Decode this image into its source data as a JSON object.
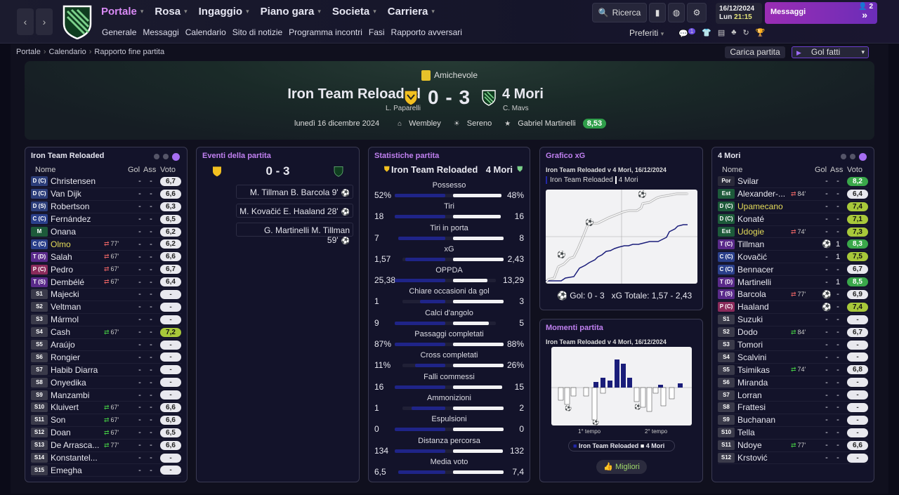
{
  "topbar": {
    "nav": [
      {
        "label": "Portale",
        "active": true
      },
      {
        "label": "Rosa"
      },
      {
        "label": "Ingaggio"
      },
      {
        "label": "Piano gara"
      },
      {
        "label": "Societa"
      },
      {
        "label": "Carriera"
      }
    ],
    "subnav": [
      "Generale",
      "Messaggi",
      "Calendario",
      "Sito di notizie",
      "Programma incontri",
      "Fasi",
      "Rapporto avversari"
    ],
    "search": "Ricerca",
    "date": "16/12/2024",
    "day": "Lun",
    "time": "21:15",
    "messages": "Messaggi",
    "msg_count": "2",
    "favorites": "Preferiti",
    "notif": "1"
  },
  "breadcrumb": [
    "Portale",
    "Calendario",
    "Rapporto fine partita"
  ],
  "actions": {
    "load": "Carica partita",
    "goals": "Gol fatti"
  },
  "match": {
    "competition": "Amichevole",
    "home": "Iron Team Reloaded",
    "home_coach": "L. Paparelli",
    "away": "4 Mori",
    "away_coach": "C. Mavs",
    "score": "0 - 3",
    "date": "lunedì 16 dicembre 2024",
    "stadium": "Wembley",
    "weather": "Sereno",
    "referee": "Gabriel Martinelli",
    "ref_rating": "8,53"
  },
  "colors": {
    "accent": "#a66ef3",
    "home_bar": "#1f2488",
    "away_bar": "#f2f2f4"
  },
  "home_lineup": {
    "title": "Iron Team Reloaded",
    "cols": [
      "Nome",
      "Gol",
      "Ass",
      "Voto"
    ],
    "players": [
      {
        "pos": "D (C)",
        "c": "#2c3e7a",
        "name": "Christensen",
        "sub": "",
        "g": "-",
        "a": "-",
        "v": "6,7"
      },
      {
        "pos": "D (C)",
        "c": "#2c3e7a",
        "name": "Van Dijk",
        "sub": "",
        "g": "-",
        "a": "-",
        "v": "6,6"
      },
      {
        "pos": "D (S)",
        "c": "#2c3e7a",
        "name": "Robertson",
        "sub": "",
        "g": "-",
        "a": "-",
        "v": "6,3"
      },
      {
        "pos": "C (C)",
        "c": "#2a3f8a",
        "name": "Fernández",
        "sub": "",
        "g": "-",
        "a": "-",
        "v": "6,5"
      },
      {
        "pos": "M",
        "c": "#1d5a3a",
        "name": "Onana",
        "sub": "",
        "g": "-",
        "a": "-",
        "v": "6,2"
      },
      {
        "pos": "C (C)",
        "c": "#2a3f8a",
        "name": "Olmo",
        "hl": true,
        "sub": "77'",
        "s": "out",
        "g": "-",
        "a": "-",
        "v": "6,2"
      },
      {
        "pos": "T (D)",
        "c": "#5a2a8a",
        "name": "Salah",
        "sub": "67'",
        "s": "out",
        "g": "-",
        "a": "-",
        "v": "6,6"
      },
      {
        "pos": "P (C)",
        "c": "#8a2a5a",
        "name": "Pedro",
        "sub": "67'",
        "s": "out",
        "g": "-",
        "a": "-",
        "v": "6,7"
      },
      {
        "pos": "T (S)",
        "c": "#5a2a8a",
        "name": "Dembélé",
        "sub": "67'",
        "s": "out",
        "g": "-",
        "a": "-",
        "v": "6,4"
      },
      {
        "pos": "S1",
        "c": "#3a3a4a",
        "name": "Majecki",
        "sub": "",
        "g": "-",
        "a": "-",
        "v": "-"
      },
      {
        "pos": "S2",
        "c": "#3a3a4a",
        "name": "Veltman",
        "sub": "",
        "g": "-",
        "a": "-",
        "v": "-"
      },
      {
        "pos": "S3",
        "c": "#3a3a4a",
        "name": "Mármol",
        "sub": "",
        "g": "-",
        "a": "-",
        "v": "-"
      },
      {
        "pos": "S4",
        "c": "#3a3a4a",
        "name": "Cash",
        "sub": "67'",
        "s": "in",
        "g": "-",
        "a": "-",
        "v": "7,2"
      },
      {
        "pos": "S5",
        "c": "#3a3a4a",
        "name": "Araújo",
        "sub": "",
        "g": "-",
        "a": "-",
        "v": "-"
      },
      {
        "pos": "S6",
        "c": "#3a3a4a",
        "name": "Rongier",
        "sub": "",
        "g": "-",
        "a": "-",
        "v": "-"
      },
      {
        "pos": "S7",
        "c": "#3a3a4a",
        "name": "Habib Diarra",
        "sub": "",
        "g": "-",
        "a": "-",
        "v": "-"
      },
      {
        "pos": "S8",
        "c": "#3a3a4a",
        "name": "Onyedika",
        "sub": "",
        "g": "-",
        "a": "-",
        "v": "-"
      },
      {
        "pos": "S9",
        "c": "#3a3a4a",
        "name": "Manzambi",
        "sub": "",
        "g": "-",
        "a": "-",
        "v": "-"
      },
      {
        "pos": "S10",
        "c": "#3a3a4a",
        "name": "Kluivert",
        "sub": "67'",
        "s": "in",
        "g": "-",
        "a": "-",
        "v": "6,6"
      },
      {
        "pos": "S11",
        "c": "#3a3a4a",
        "name": "Son",
        "sub": "67'",
        "s": "in",
        "g": "-",
        "a": "-",
        "v": "6,6"
      },
      {
        "pos": "S12",
        "c": "#3a3a4a",
        "name": "Doan",
        "sub": "67'",
        "s": "in",
        "g": "-",
        "a": "-",
        "v": "6,5"
      },
      {
        "pos": "S13",
        "c": "#3a3a4a",
        "name": "De Arrasca...",
        "sub": "77'",
        "s": "in",
        "g": "-",
        "a": "-",
        "v": "6,6"
      },
      {
        "pos": "S14",
        "c": "#3a3a4a",
        "name": "Konstantel...",
        "sub": "",
        "g": "-",
        "a": "-",
        "v": "-"
      },
      {
        "pos": "S15",
        "c": "#3a3a4a",
        "name": "Emegha",
        "sub": "",
        "g": "-",
        "a": "-",
        "v": "-"
      }
    ]
  },
  "events": {
    "title": "Eventi della partita",
    "score": "0 - 3",
    "rows": [
      "M. Tillman B. Barcola 9'",
      "M. Kovačić E. Haaland 28'",
      "G. Martinelli M. Tillman 59'"
    ]
  },
  "stats": {
    "title": "Statistiche partita",
    "home": "Iron Team Reloaded",
    "away": "4 Mori",
    "rows": [
      {
        "label": "Possesso",
        "h": "52%",
        "a": "48%",
        "hv": 52,
        "av": 48
      },
      {
        "label": "Tiri",
        "h": "18",
        "a": "16",
        "hv": 18,
        "av": 16
      },
      {
        "label": "Tiri in porta",
        "h": "7",
        "a": "8",
        "hv": 7,
        "av": 8
      },
      {
        "label": "xG",
        "h": "1,57",
        "a": "2,43",
        "hv": 1.57,
        "av": 2.43
      },
      {
        "label": "OPPDA",
        "h": "25,38",
        "a": "13,29",
        "hv": 25.38,
        "av": 13.29
      },
      {
        "label": "Chiare occasioni da gol",
        "h": "1",
        "a": "3",
        "hv": 1,
        "av": 3
      },
      {
        "label": "Calci d'angolo",
        "h": "9",
        "a": "5",
        "hv": 9,
        "av": 5
      },
      {
        "label": "Passaggi completati",
        "h": "87%",
        "a": "88%",
        "hv": 87,
        "av": 88
      },
      {
        "label": "Cross completati",
        "h": "11%",
        "a": "26%",
        "hv": 11,
        "av": 26
      },
      {
        "label": "Falli commessi",
        "h": "16",
        "a": "15",
        "hv": 16,
        "av": 15
      },
      {
        "label": "Ammonizioni",
        "h": "1",
        "a": "2",
        "hv": 1,
        "av": 2
      },
      {
        "label": "Espulsioni",
        "h": "0",
        "a": "0",
        "hv": 0,
        "av": 0
      },
      {
        "label": "Distanza percorsa",
        "h": "134",
        "a": "132",
        "hv": 134,
        "av": 132
      },
      {
        "label": "Media voto",
        "h": "6,5",
        "a": "7,4",
        "hv": 6.5,
        "av": 7.4
      }
    ]
  },
  "xg": {
    "title": "Grafico xG",
    "subtitle": "Iron Team Reloaded v 4 Mori, 16/12/2024",
    "legend_home": "Iron Team Reloaded",
    "legend_away": "4 Mori",
    "goals": "Gol: 0 - 3",
    "total": "xG Totale: 1,57 - 2,43"
  },
  "moments": {
    "title": "Momenti partita",
    "subtitle": "Iron Team Reloaded v 4 Mori, 16/12/2024",
    "first": "1° tempo",
    "second": "2° tempo",
    "legend_home": "Iron Team Reloaded",
    "legend_away": "4 Mori",
    "button": "Migliori"
  },
  "away_lineup": {
    "title": "4 Mori",
    "cols": [
      "Nome",
      "Gol",
      "Ass",
      "Voto"
    ],
    "players": [
      {
        "pos": "Por",
        "c": "#2a2a3a",
        "name": "Svilar",
        "sub": "",
        "g": "-",
        "a": "-",
        "v": "8,2"
      },
      {
        "pos": "Est",
        "c": "#1d5a3a",
        "name": "Alexander-...",
        "sub": "84'",
        "s": "out",
        "g": "-",
        "a": "-",
        "v": "6,4"
      },
      {
        "pos": "D (C)",
        "c": "#1d5a3a",
        "name": "Upamecano",
        "hl": true,
        "sub": "",
        "g": "-",
        "a": "-",
        "v": "7,4"
      },
      {
        "pos": "D (C)",
        "c": "#1d5a3a",
        "name": "Konaté",
        "sub": "",
        "g": "-",
        "a": "-",
        "v": "7,1"
      },
      {
        "pos": "Est",
        "c": "#1d5a3a",
        "name": "Udogie",
        "hl": true,
        "sub": "74'",
        "s": "out",
        "g": "-",
        "a": "-",
        "v": "7,3"
      },
      {
        "pos": "T (C)",
        "c": "#5a2a8a",
        "name": "Tillman",
        "sub": "",
        "g": "⚽",
        "a": "1",
        "v": "8,3"
      },
      {
        "pos": "C (C)",
        "c": "#2a3f8a",
        "name": "Kovačić",
        "sub": "",
        "g": "-",
        "a": "1",
        "v": "7,5"
      },
      {
        "pos": "C (C)",
        "c": "#2a3f8a",
        "name": "Bennacer",
        "sub": "",
        "g": "-",
        "a": "-",
        "v": "6,7"
      },
      {
        "pos": "T (D)",
        "c": "#5a2a8a",
        "name": "Martinelli",
        "sub": "",
        "g": "-",
        "a": "1",
        "v": "8,5"
      },
      {
        "pos": "T (S)",
        "c": "#5a2a8a",
        "name": "Barcola",
        "sub": "77'",
        "s": "out",
        "g": "⚽",
        "a": "-",
        "v": "6,9"
      },
      {
        "pos": "P (C)",
        "c": "#8a2a5a",
        "name": "Haaland",
        "sub": "",
        "g": "⚽",
        "a": "-",
        "v": "7,4"
      },
      {
        "pos": "S1",
        "c": "#3a3a4a",
        "name": "Suzuki",
        "sub": "",
        "g": "-",
        "a": "-",
        "v": "-"
      },
      {
        "pos": "S2",
        "c": "#3a3a4a",
        "name": "Dodo",
        "sub": "84'",
        "s": "in",
        "g": "-",
        "a": "-",
        "v": "6,7"
      },
      {
        "pos": "S3",
        "c": "#3a3a4a",
        "name": "Tomori",
        "sub": "",
        "g": "-",
        "a": "-",
        "v": "-"
      },
      {
        "pos": "S4",
        "c": "#3a3a4a",
        "name": "Scalvini",
        "sub": "",
        "g": "-",
        "a": "-",
        "v": "-"
      },
      {
        "pos": "S5",
        "c": "#3a3a4a",
        "name": "Tsimikas",
        "sub": "74'",
        "s": "in",
        "g": "-",
        "a": "-",
        "v": "6,8"
      },
      {
        "pos": "S6",
        "c": "#3a3a4a",
        "name": "Miranda",
        "sub": "",
        "g": "-",
        "a": "-",
        "v": "-"
      },
      {
        "pos": "S7",
        "c": "#3a3a4a",
        "name": "Lorran",
        "sub": "",
        "g": "-",
        "a": "-",
        "v": "-"
      },
      {
        "pos": "S8",
        "c": "#3a3a4a",
        "name": "Frattesi",
        "sub": "",
        "g": "-",
        "a": "-",
        "v": "-"
      },
      {
        "pos": "S9",
        "c": "#3a3a4a",
        "name": "Buchanan",
        "sub": "",
        "g": "-",
        "a": "-",
        "v": "-"
      },
      {
        "pos": "S10",
        "c": "#3a3a4a",
        "name": "Tella",
        "sub": "",
        "g": "-",
        "a": "-",
        "v": "-"
      },
      {
        "pos": "S11",
        "c": "#3a3a4a",
        "name": "Ndoye",
        "sub": "77'",
        "s": "in",
        "g": "-",
        "a": "-",
        "v": "6,6"
      },
      {
        "pos": "S12",
        "c": "#3a3a4a",
        "name": "Krstović",
        "sub": "",
        "g": "-",
        "a": "-",
        "v": "-"
      }
    ]
  }
}
